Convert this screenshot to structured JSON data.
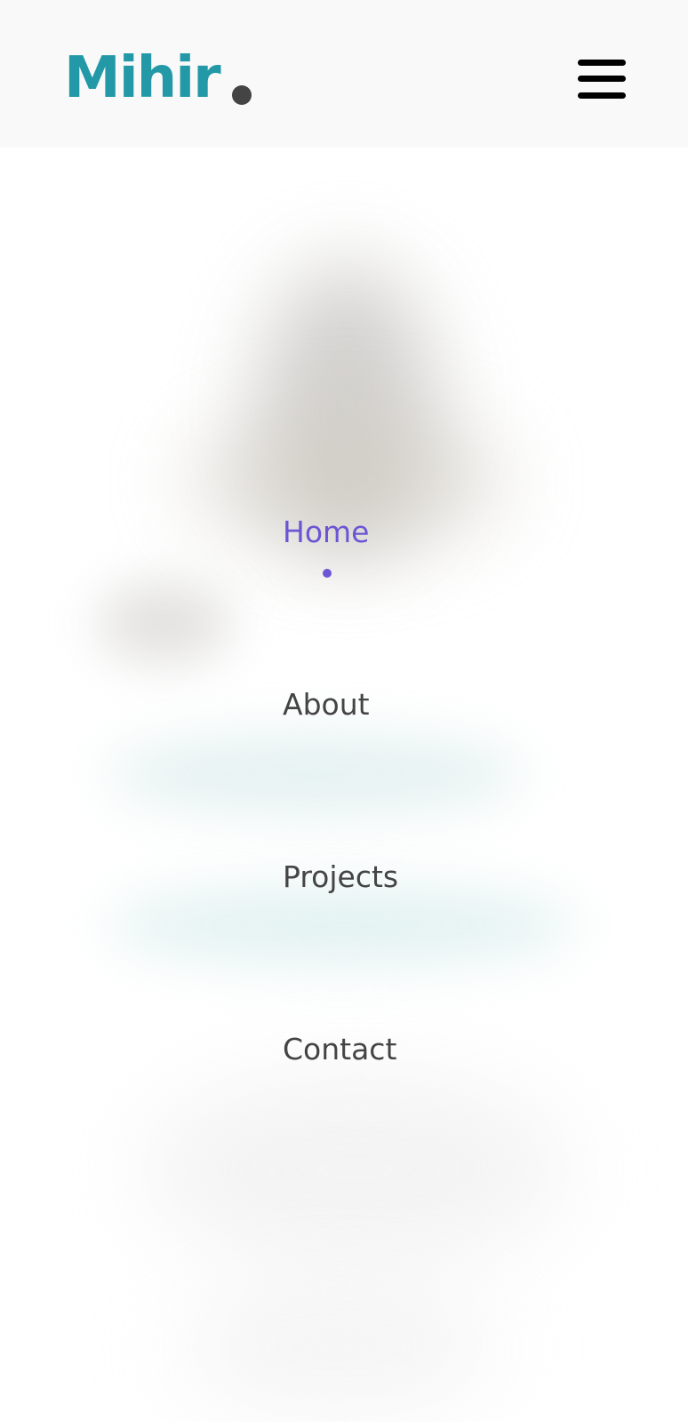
{
  "header": {
    "logo_text": "Mihir",
    "menu_icon": "hamburger-menu-icon"
  },
  "nav": {
    "items": [
      {
        "label": "Home",
        "active": true
      },
      {
        "label": "About",
        "active": false
      },
      {
        "label": "Projects",
        "active": false
      },
      {
        "label": "Contact",
        "active": false
      }
    ]
  },
  "colors": {
    "brand": "#2399a7",
    "active_nav": "#6c55d4",
    "text": "#444444",
    "header_bg": "#f9f9f9"
  }
}
